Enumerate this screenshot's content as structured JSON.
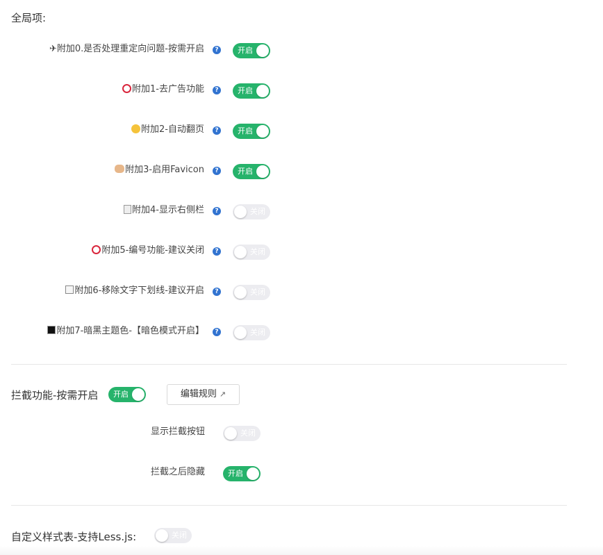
{
  "global": {
    "title": "全局项:",
    "items": [
      {
        "glyph": "✈",
        "label": "附加0.是否处理重定向问题-按需开启",
        "state": "开启",
        "on": true
      },
      {
        "glyph": "",
        "label": "附加1-去广告功能",
        "state": "开启",
        "on": true
      },
      {
        "glyph": "",
        "label": "附加2-自动翻页",
        "state": "开启",
        "on": true
      },
      {
        "glyph": "",
        "label": "附加3-启用Favicon",
        "state": "开启",
        "on": true
      },
      {
        "glyph": "",
        "label": "附加4-显示右侧栏",
        "state": "关闭",
        "on": false
      },
      {
        "glyph": "",
        "label": "附加5-编号功能-建议关闭",
        "state": "关闭",
        "on": false
      },
      {
        "glyph": "",
        "label": "附加6-移除文字下划线-建议开启",
        "state": "关闭",
        "on": false
      },
      {
        "glyph": "",
        "label": "附加7-暗黑主题色-【暗色模式开启】",
        "state": "关闭",
        "on": false
      }
    ],
    "help": "?"
  },
  "intercept": {
    "title": "拦截功能-按需开启",
    "state": "开启",
    "edit_button": "编辑规则",
    "edit_icon": "external-link-icon",
    "sub": [
      {
        "label": "显示拦截按钮",
        "state": "关闭",
        "on": false
      },
      {
        "label": "拦截之后隐藏",
        "state": "开启",
        "on": true
      }
    ]
  },
  "custom_css": {
    "title": "自定义样式表-支持Less.js:",
    "state": "关闭"
  },
  "colors": {
    "on": "#26b36b",
    "off": "#ececf0",
    "help": "#3173d0"
  }
}
